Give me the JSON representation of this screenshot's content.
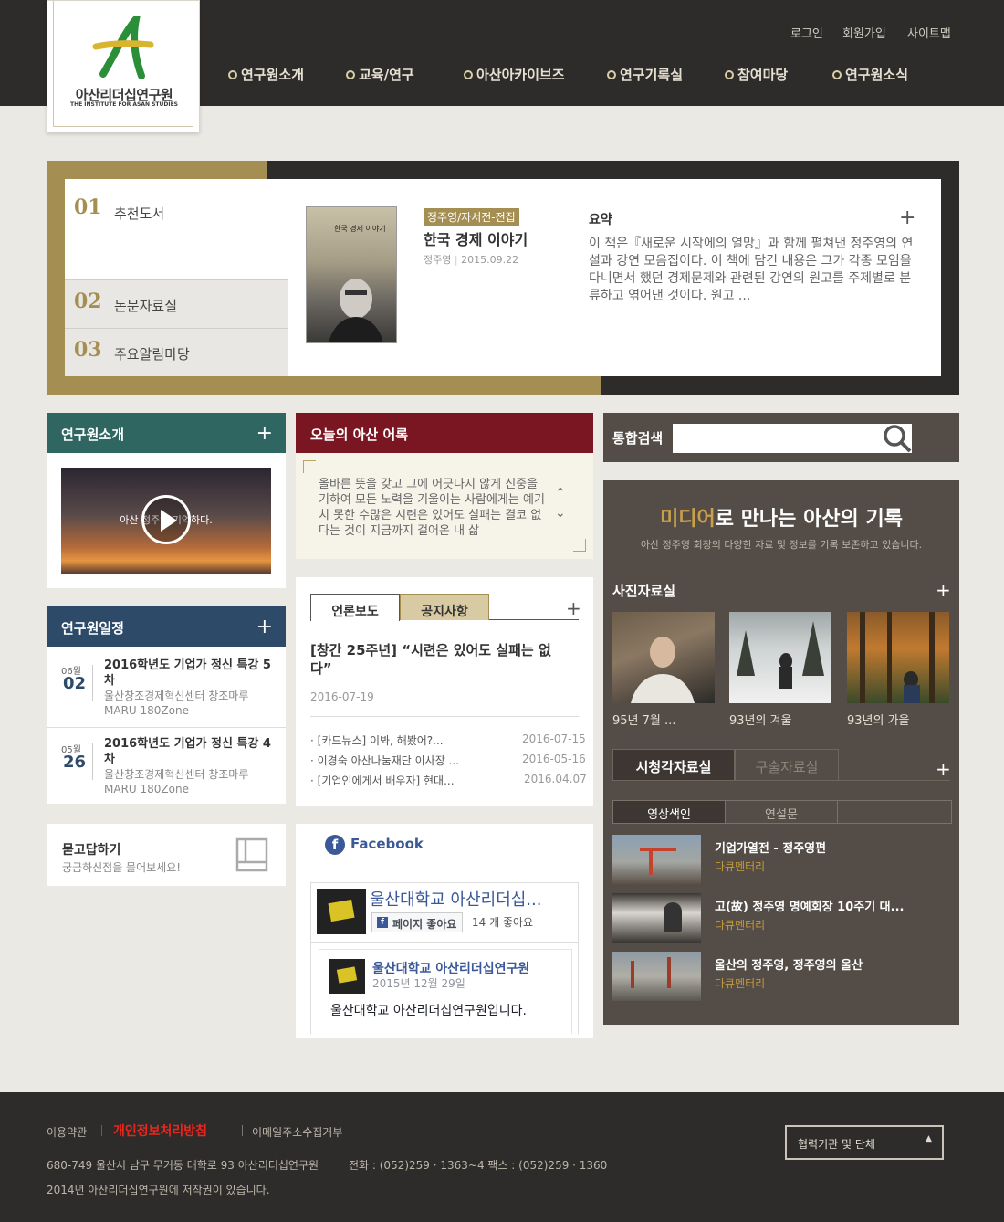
{
  "header": {
    "logo_kr": "아산리더십연구원",
    "logo_en": "THE INSTITUTE FOR ASAN STUDIES",
    "util": [
      "로그인",
      "회원가입",
      "사이트맵"
    ],
    "nav": [
      "연구원소개",
      "교육/연구",
      "아산아카이브즈",
      "연구기록실",
      "참여마당",
      "연구원소식"
    ]
  },
  "feature": {
    "tabs": [
      {
        "num": "01",
        "label": "추천도서"
      },
      {
        "num": "02",
        "label": "논문자료실"
      },
      {
        "num": "03",
        "label": "주요알림마당"
      }
    ],
    "book": {
      "cover_title": "한국 경제 이야기",
      "category": "정주영/자서전-전집",
      "title": "한국 경제 이야기",
      "author": "정주영",
      "date": "2015.09.22"
    },
    "summary_heading": "요약",
    "summary_text": "이 책은『새로운 시작에의 열망』과 함께 펼쳐낸 정주영의 연설과 강연 모음집이다. 이 책에 담긴 내용은 그가 각종 모임을 다니면서 했던 경제문제와 관련된 강연의 원고를 주제별로 분류하고 엮어낸 것이다. 원고 ..."
  },
  "about": {
    "heading": "연구원소개",
    "video_text": "아산 정주영 기억하다."
  },
  "schedule": {
    "heading": "연구원일정",
    "items": [
      {
        "month": "06월",
        "day": "02",
        "title": "2016학년도 기업가 정신 특강 5차",
        "place": "울산창조경제혁신센터 창조마루 MARU 180Zone"
      },
      {
        "month": "05월",
        "day": "26",
        "title": "2016학년도 기업가 정신 특강 4차",
        "place": "울산창조경제혁신센터 창조마루 MARU 180Zone"
      }
    ]
  },
  "qna": {
    "title": "묻고답하기",
    "subtitle": "궁금하신점을 물어보세요!"
  },
  "quote": {
    "heading": "오늘의 아산 어록",
    "text": "올바른 뜻을 갖고 그에 어긋나지 않게 신중을 기하여 모든 노력을 기울이는 사람에게는 예기치 못한 수많은 시련은 있어도 실패는 결코 없다는 것이 지금까지 걸어온 내 삶"
  },
  "news": {
    "tabs": [
      "언론보도",
      "공지사항"
    ],
    "headline": "[창간 25주년] “시련은 있어도 실패는 없다”",
    "headline_date": "2016-07-19",
    "items": [
      {
        "title": "[카드뉴스] 이봐, 해봤어?...",
        "date": "2016-07-15"
      },
      {
        "title": "이경숙 아산나눔재단 이사장 ...",
        "date": "2016-05-16"
      },
      {
        "title": "[기업인에게서 배우자] 현대...",
        "date": "2016.04.07"
      }
    ]
  },
  "facebook": {
    "label": "Facebook",
    "page_name": "울산대학교 아산리더십...",
    "like_button": "페이지 좋아요",
    "like_count": "14 개 좋아요",
    "post_author": "울산대학교 아산리더십연구원",
    "post_date": "2015년 12월 29일",
    "post_text": "울산대학교 아산리더십연구원입니다."
  },
  "search": {
    "label": "통합검색",
    "value": ""
  },
  "media": {
    "title_accent": "미디어",
    "title_rest": "로 만나는 아산의 기록",
    "subtitle": "아산 정주영 회장의 다양한 자료 및 정보를 기록 보존하고 있습니다.",
    "photo_heading": "사진자료실",
    "photos": [
      "95년 7월 ...",
      "93년의 겨울",
      "93년의 가을"
    ],
    "av_tabs": [
      "시청각자료실",
      "구술자료실"
    ],
    "sub_tabs": [
      "영상색인",
      "연설문"
    ],
    "videos": [
      {
        "title": "기업가열전 - 정주영편",
        "type": "다큐멘터리"
      },
      {
        "title": "고(故) 정주영 명예회장 10주기 대...",
        "type": "다큐멘터리"
      },
      {
        "title": "울산의 정주영, 정주영의 울산",
        "type": "다큐멘터리"
      }
    ]
  },
  "footer": {
    "links": [
      "이용약관",
      "개인정보처리방침",
      "이메일주소수집거부"
    ],
    "address": "680-749 울산시 남구 무거동 대학로 93 아산리더십연구원",
    "phone": "전화 : (052)259 · 1363~4 팩스 : (052)259 · 1360",
    "copyright": "2014년 아산리더십연구원에 저작권이 있습니다.",
    "partner_select": "협력기관 및 단체"
  },
  "colors": {
    "gold": "#a58e52",
    "dark": "#2e2c2a",
    "teal": "#2f6662",
    "navy": "#2d4a68",
    "burgundy": "#7a1622",
    "media_bg": "#544c46"
  }
}
